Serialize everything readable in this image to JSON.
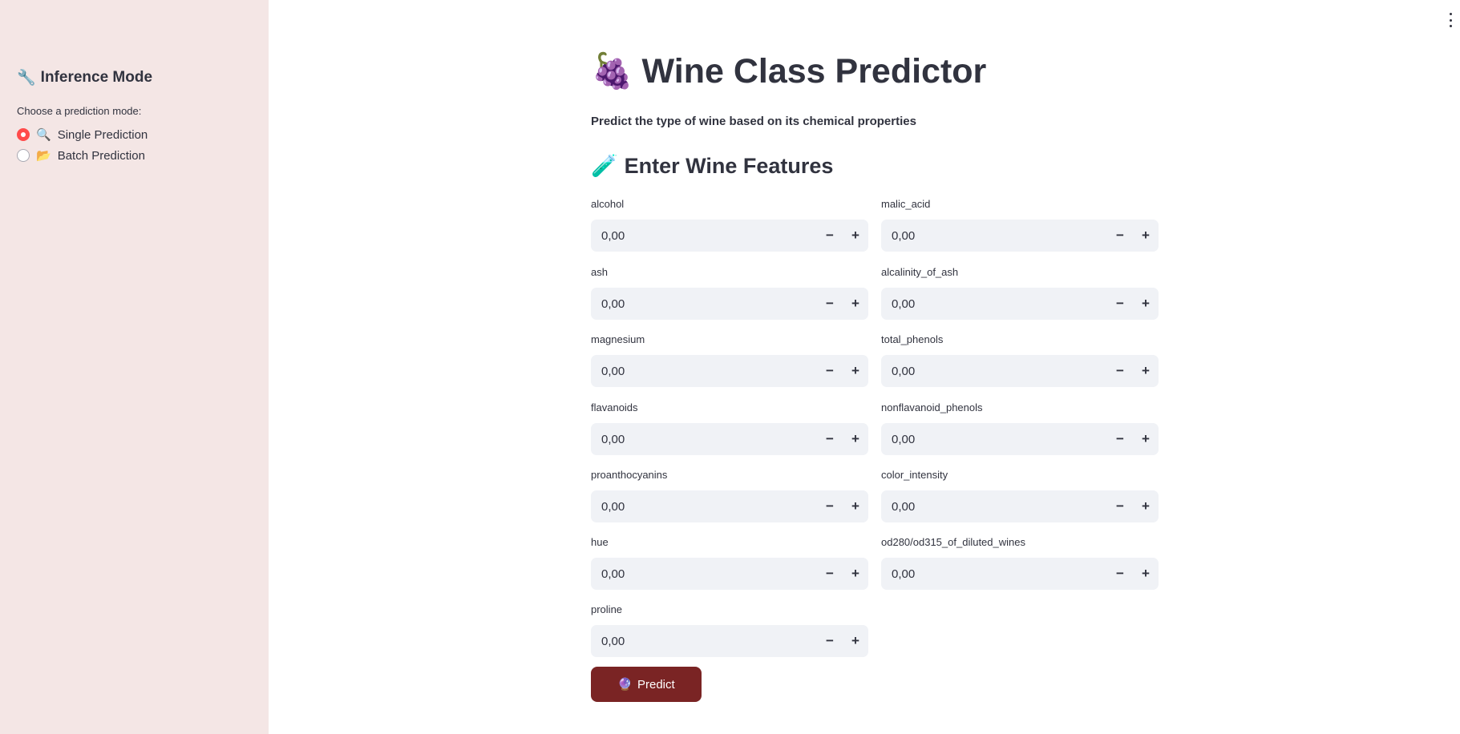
{
  "sidebar": {
    "title_icon": "🔧",
    "title": "Inference Mode",
    "caption": "Choose a prediction mode:",
    "options": [
      {
        "icon": "🔍",
        "label": "Single Prediction",
        "selected": true
      },
      {
        "icon": "📂",
        "label": "Batch Prediction",
        "selected": false
      }
    ]
  },
  "main": {
    "title_icon": "🍇",
    "title": "Wine Class Predictor",
    "subtitle": "Predict the type of wine based on its chemical properties",
    "section_icon": "🧪",
    "section_title": "Enter Wine Features",
    "fields": [
      {
        "label": "alcohol",
        "value": "0,00"
      },
      {
        "label": "malic_acid",
        "value": "0,00"
      },
      {
        "label": "ash",
        "value": "0,00"
      },
      {
        "label": "alcalinity_of_ash",
        "value": "0,00"
      },
      {
        "label": "magnesium",
        "value": "0,00"
      },
      {
        "label": "total_phenols",
        "value": "0,00"
      },
      {
        "label": "flavanoids",
        "value": "0,00"
      },
      {
        "label": "nonflavanoid_phenols",
        "value": "0,00"
      },
      {
        "label": "proanthocyanins",
        "value": "0,00"
      },
      {
        "label": "color_intensity",
        "value": "0,00"
      },
      {
        "label": "hue",
        "value": "0,00"
      },
      {
        "label": "od280/od315_of_diluted_wines",
        "value": "0,00"
      },
      {
        "label": "proline",
        "value": "0,00"
      }
    ],
    "stepper_minus": "−",
    "stepper_plus": "+",
    "predict_icon": "🔮",
    "predict_label": "Predict"
  },
  "colors": {
    "sidebar_bg": "#f4e6e5",
    "radio_accent": "#ff4b4b",
    "button_bg": "#7a2424",
    "input_bg": "#f0f2f6"
  }
}
